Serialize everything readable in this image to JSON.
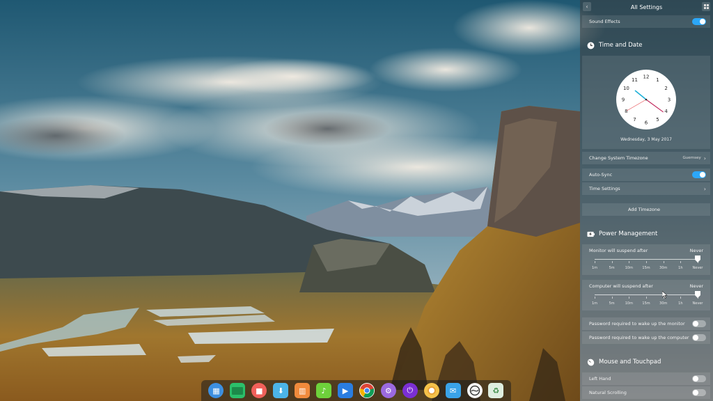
{
  "wallpaper": {
    "description_icon": "mountain-valley-wallpaper"
  },
  "panel": {
    "title": "All Settings",
    "back_icon": "chevron-left-icon",
    "layout_icon": "grid-icon",
    "sound_effects": {
      "label": "Sound Effects",
      "enabled": true
    },
    "time_and_date": {
      "title": "Time and Date",
      "icon": "clock-icon",
      "clock": {
        "numbers": [
          "12",
          "1",
          "2",
          "3",
          "4",
          "5",
          "6",
          "7",
          "8",
          "9",
          "10",
          "11"
        ],
        "hour": 10.3,
        "minute": 21,
        "second": 40
      },
      "date_text": "Wednesday, 3 May 2017",
      "change_timezone_label": "Change System Timezone",
      "timezone_value": "Guernsey",
      "auto_sync": {
        "label": "Auto-Sync",
        "enabled": true
      },
      "time_settings_label": "Time Settings",
      "add_timezone_label": "Add Timezone"
    },
    "power_management": {
      "title": "Power Management",
      "icon": "battery-icon",
      "monitor": {
        "label": "Monitor will suspend after",
        "value": "Never",
        "selected_index": 6
      },
      "computer": {
        "label": "Computer will suspend after",
        "value": "Never",
        "selected_index": 6
      },
      "tick_labels": [
        "1m",
        "5m",
        "10m",
        "15m",
        "30m",
        "1h",
        "Never"
      ],
      "password_monitor": {
        "label": "Password required to wake up the monitor",
        "enabled": false
      },
      "password_computer": {
        "label": "Password required to wake up the computer",
        "enabled": false
      }
    },
    "mouse_touchpad": {
      "title": "Mouse and Touchpad",
      "icon": "mouse-icon",
      "left_hand": {
        "label": "Left Hand",
        "enabled": false
      },
      "natural_scrolling": {
        "label": "Natural Scrolling",
        "enabled": false
      }
    }
  },
  "dock": {
    "apps": [
      {
        "name": "launcher-icon",
        "color": "#3d8fe0",
        "round": true,
        "glyph": "▦"
      },
      {
        "name": "terminal-icon",
        "color": "#2bbf6a",
        "round": false,
        "glyph": ""
      },
      {
        "name": "screen-recorder-icon",
        "color": "#f0605a",
        "round": true,
        "glyph": "■"
      },
      {
        "name": "app-store-icon",
        "color": "#4cb4e8",
        "round": false,
        "glyph": "⬇"
      },
      {
        "name": "file-manager-icon",
        "color": "#f08a3c",
        "round": false,
        "glyph": "▥"
      },
      {
        "name": "music-player-icon",
        "color": "#6ed13b",
        "round": false,
        "glyph": "♪"
      },
      {
        "name": "video-player-icon",
        "color": "#2a7de1",
        "round": false,
        "glyph": "▶"
      },
      {
        "name": "chrome-icon",
        "color": "#ffffff",
        "round": true,
        "glyph": ""
      },
      {
        "name": "settings-icon",
        "color": "#9b6ae0",
        "round": true,
        "glyph": "⚙"
      },
      {
        "name": "shutdown-icon",
        "color": "#7b2fd4",
        "round": true,
        "glyph": "⏻"
      },
      {
        "name": "image-viewer-icon",
        "color": "#f4c24a",
        "round": true,
        "glyph": ""
      },
      {
        "name": "mail-icon",
        "color": "#3aa3e8",
        "round": false,
        "glyph": "✉"
      },
      {
        "name": "deepin-icon",
        "color": "#f5f5f5",
        "round": true,
        "glyph": ""
      },
      {
        "name": "trash-icon",
        "color": "#dfeee0",
        "round": false,
        "glyph": "♻"
      }
    ]
  }
}
